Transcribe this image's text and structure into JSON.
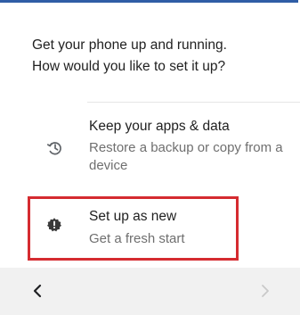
{
  "prompt": {
    "line1": "Get your phone up and running.",
    "line2": "How would you like to set it up?"
  },
  "options": [
    {
      "icon": "restore-history-icon",
      "title": "Keep your apps & data",
      "subtitle": "Restore a backup or copy from a device"
    },
    {
      "icon": "new-device-icon",
      "title": "Set up as new",
      "subtitle": "Get a fresh start"
    }
  ],
  "navigation": {
    "back_icon": "chevron-left-icon",
    "next_icon": "chevron-right-icon"
  },
  "colors": {
    "accent_top_bar": "#2f5da6",
    "highlight_border": "#d52b30",
    "primary_text": "#212121",
    "secondary_text": "#6f6f6f",
    "bottom_bar": "#f1f1f1"
  }
}
